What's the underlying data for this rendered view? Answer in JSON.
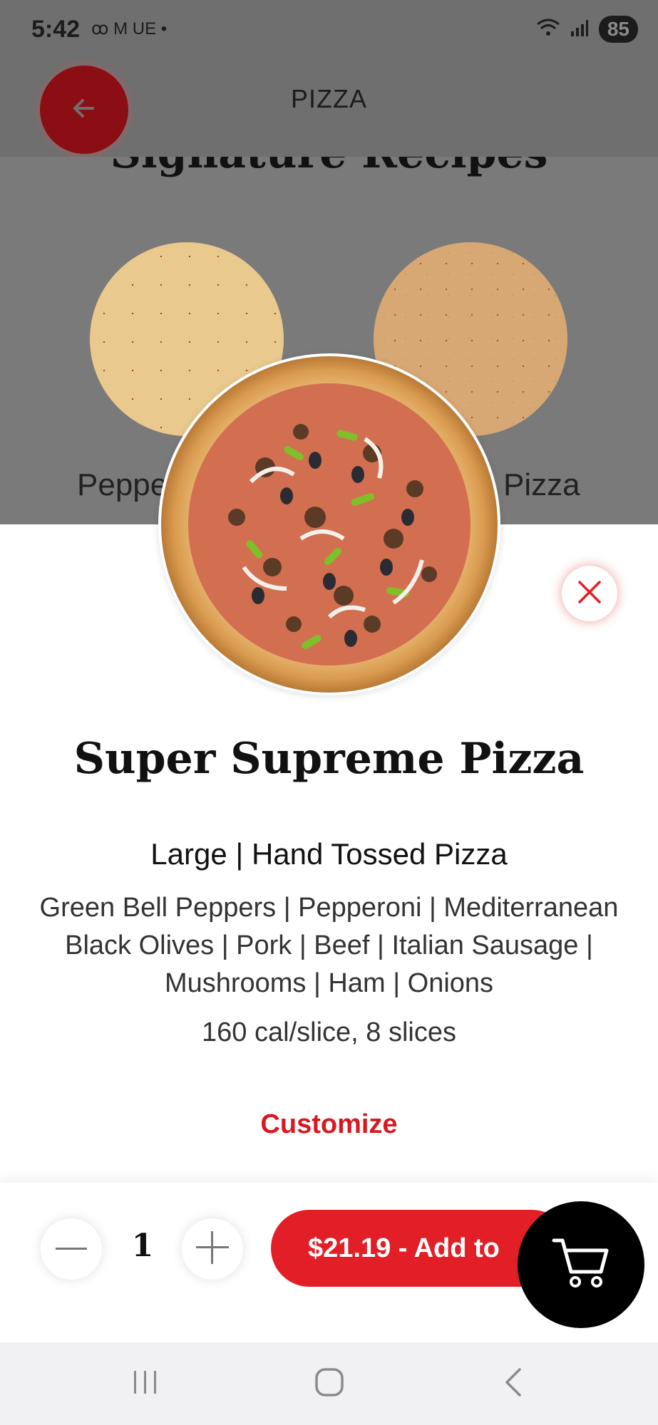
{
  "status_bar": {
    "time": "5:42",
    "left_icons": "ꝏ M UE •",
    "battery": "85"
  },
  "header": {
    "title": "PIZZA",
    "back_icon": "arrow-left-icon"
  },
  "background": {
    "section_title": "Signature Recipes",
    "cards": [
      {
        "label": "Peppe"
      },
      {
        "label": "Pizza"
      }
    ]
  },
  "product": {
    "name": "Super Supreme Pizza",
    "size": "Large |  Hand Tossed Pizza",
    "toppings": "Green Bell Peppers | Pepperoni | Mediterranean Black Olives | Pork | Beef | Italian Sausage | Mushrooms | Ham | Onions",
    "calories": "160 cal/slice, 8 slices",
    "customize_label": "Customize"
  },
  "order": {
    "quantity": "1",
    "add_label": "$21.19 -  Add to"
  },
  "colors": {
    "accent": "#e21f26",
    "accent_dark": "#8b0e14",
    "overlay": "#7a7a7a"
  }
}
